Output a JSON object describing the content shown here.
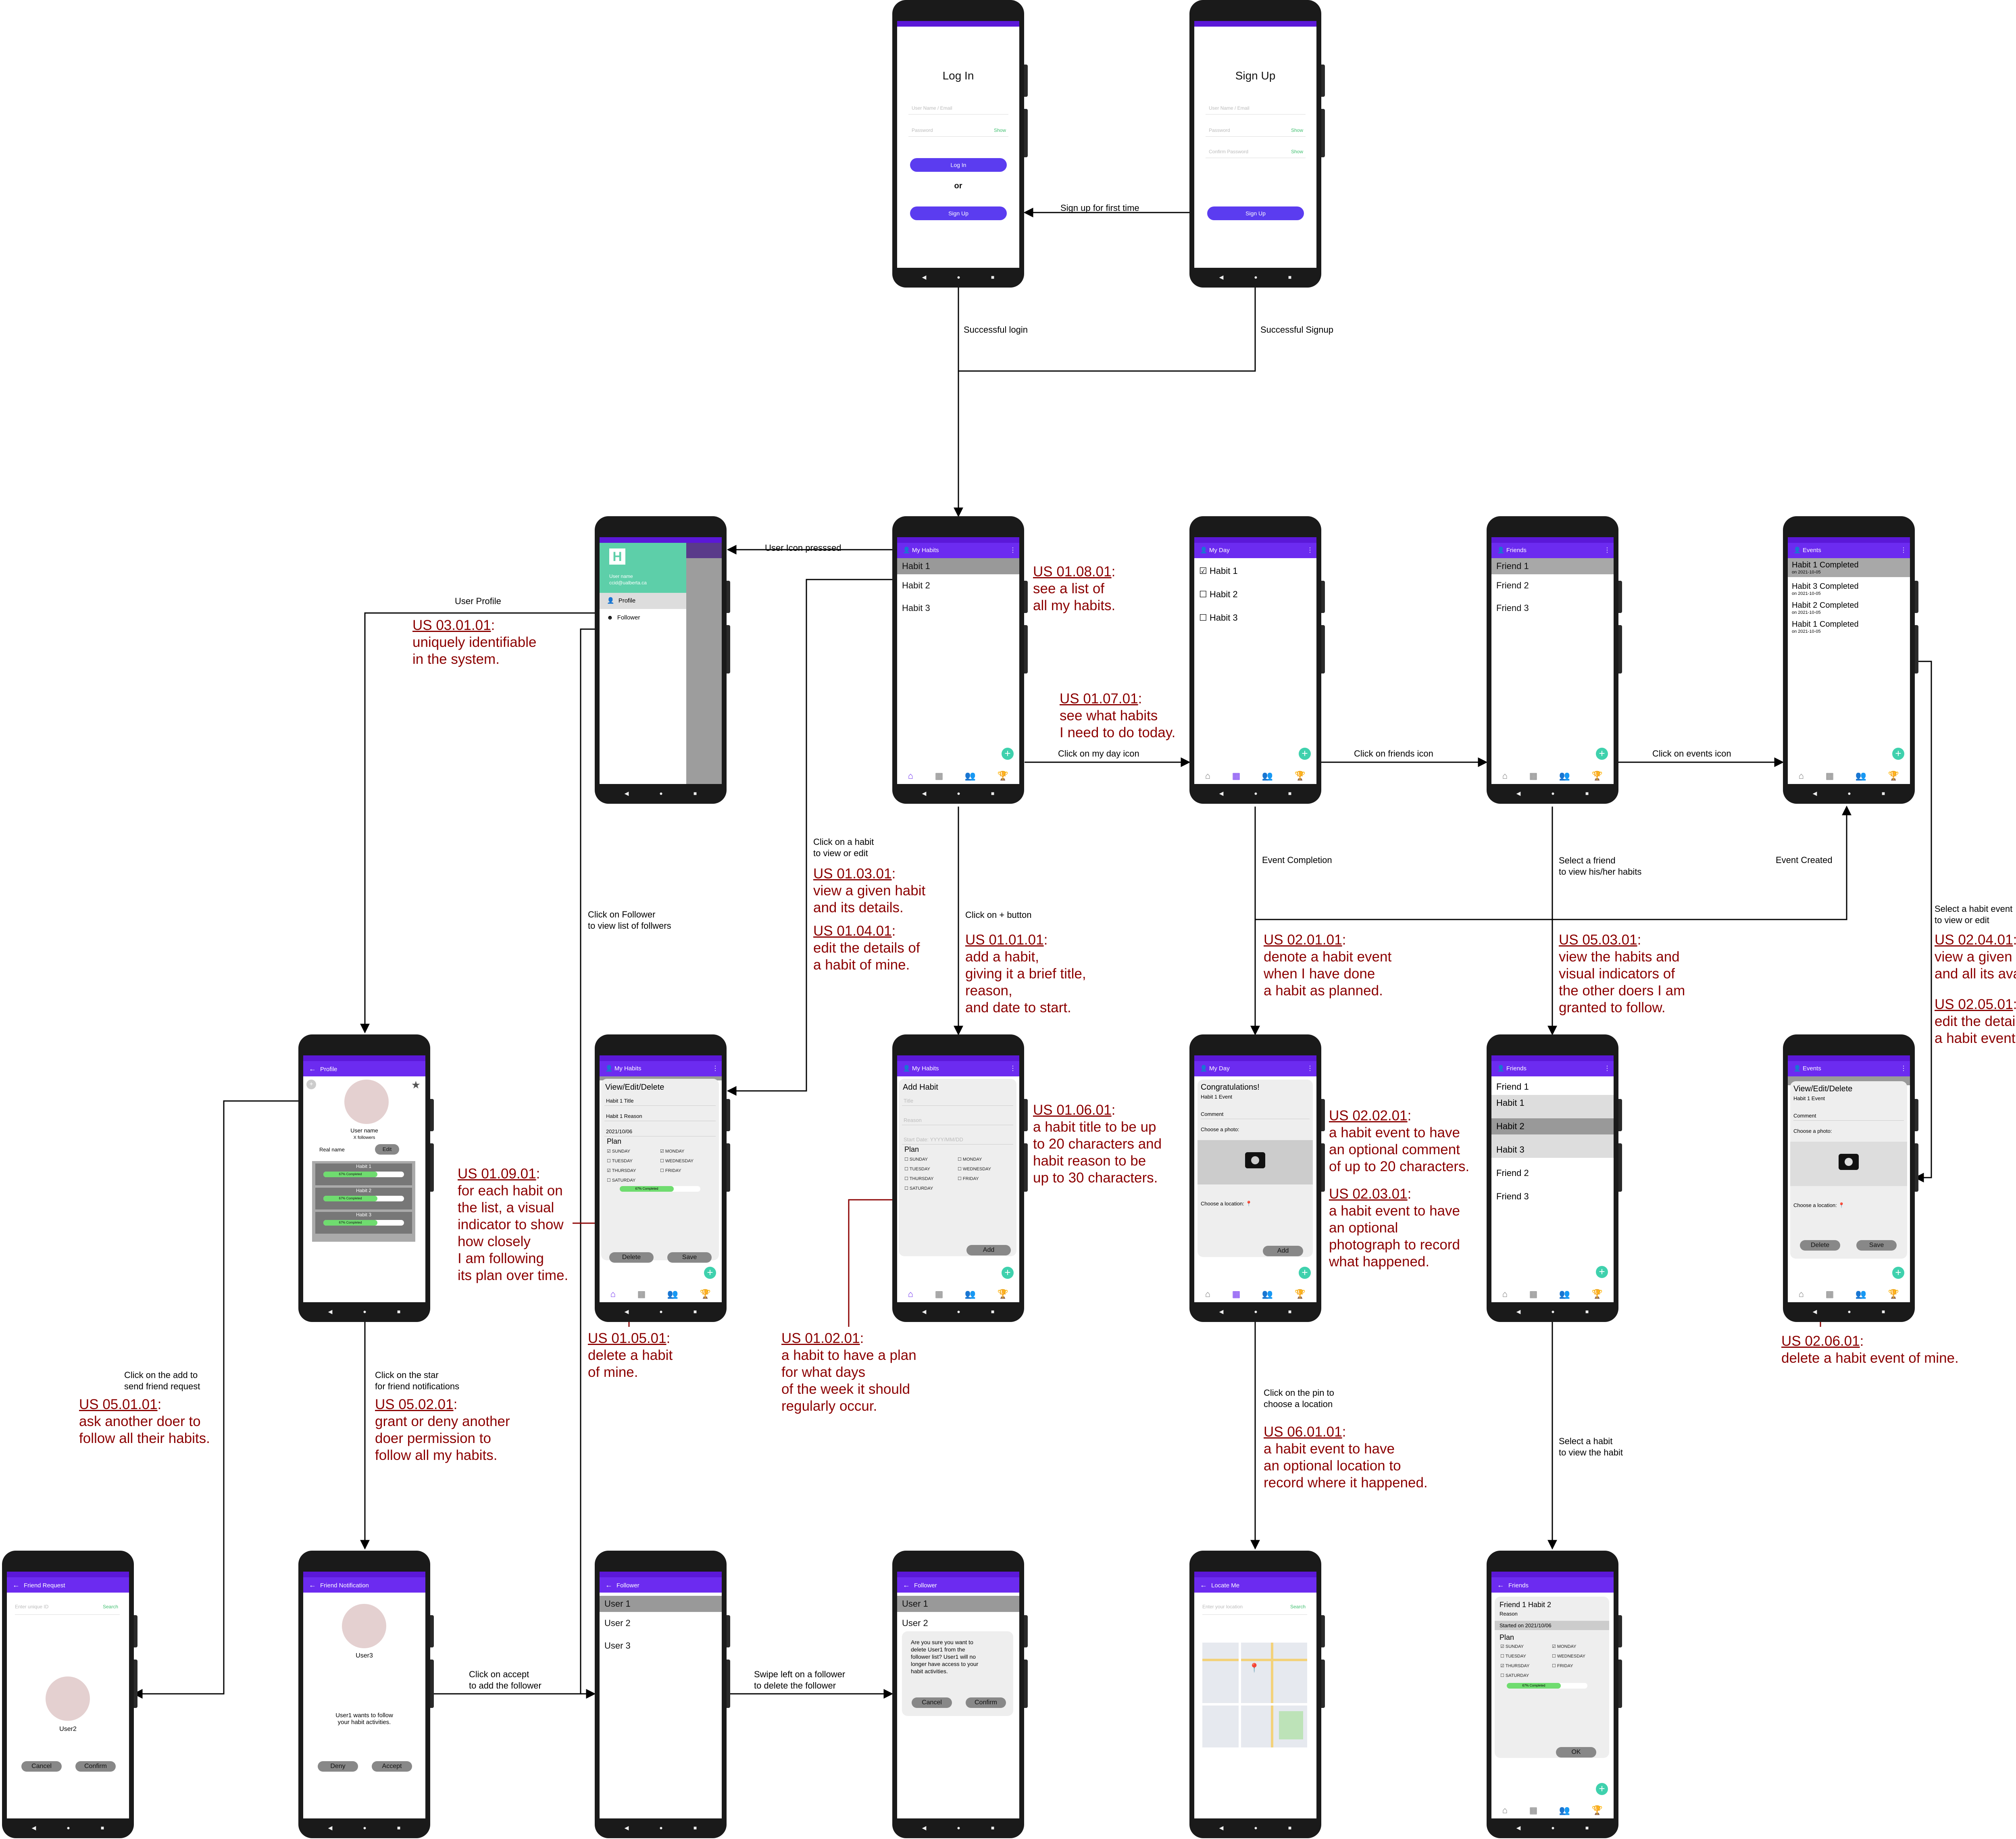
{
  "phones": {
    "login": {
      "title": "Log In",
      "user_ph": "User Name / Email",
      "pass_ph": "Password",
      "show": "Show",
      "login_btn": "Log In",
      "or": "or",
      "signup_btn": "Sign Up"
    },
    "signup": {
      "title": "Sign Up",
      "user_ph": "User Name / Email",
      "pass_ph": "Password",
      "confirm_ph": "Confirm Password",
      "show": "Show",
      "signup_btn": "Sign Up"
    },
    "drawer": {
      "user": "User name",
      "email": "ccid@ualberta.ca",
      "profile": "Profile",
      "follower": "Follower"
    },
    "myhabits": {
      "title": "My Habits",
      "items": [
        "Habit 1",
        "Habit 2",
        "Habit 3"
      ]
    },
    "myday": {
      "title": "My Day",
      "items": [
        "Habit 1",
        "Habit 2",
        "Habit 3"
      ]
    },
    "friends": {
      "title": "Friends",
      "items": [
        "Friend 1",
        "Friend 2",
        "Friend 3"
      ]
    },
    "events": {
      "title": "Events",
      "items": [
        {
          "t": "Habit 1 Completed",
          "d": "on 2021-10-05"
        },
        {
          "t": "Habit 3 Completed",
          "d": "on 2021-10-05"
        },
        {
          "t": "Habit 2 Completed",
          "d": "on 2021-10-05"
        },
        {
          "t": "Habit 1 Completed",
          "d": "on 2021-10-05"
        }
      ]
    },
    "profile": {
      "title": "Profile",
      "user": "User name",
      "followers": "X followers",
      "real": "Real name",
      "edit": "Edit",
      "habits": [
        "Habit 1",
        "Habit 2",
        "Habit 3"
      ],
      "progress": "67% Completed"
    },
    "vedhabit": {
      "title": "My Habits",
      "card": "View/Edit/Delete",
      "t": "Habit 1 Title",
      "r": "Habit 1 Reason",
      "date": "2021/10/06",
      "plan": "Plan",
      "days": [
        "SUNDAY",
        "MONDAY",
        "TUESDAY",
        "WEDNESDAY",
        "THURSDAY",
        "FRIDAY",
        "SATURDAY"
      ],
      "progress": "67% Completed",
      "delete": "Delete",
      "save": "Save"
    },
    "addhabit": {
      "title": "My Habits",
      "card": "Add Habit",
      "t": "Title",
      "r": "Reason",
      "date": "Start Date: YYYY/MM/DD",
      "plan": "Plan",
      "days": [
        "SUNDAY",
        "MONDAY",
        "TUESDAY",
        "WEDNESDAY",
        "THURSDAY",
        "FRIDAY",
        "SATURDAY"
      ],
      "add": "Add"
    },
    "congrats": {
      "title": "My Day",
      "card": "Congratulations!",
      "ev": "Habit 1 Event",
      "comment": "Comment",
      "photo": "Choose a photo:",
      "loc": "Choose a location:",
      "add": "Add"
    },
    "friends2": {
      "title": "Friends",
      "items": [
        "Friend 1",
        "Habit 1",
        "Habit 2",
        "Habit 3",
        "Friend 2",
        "Friend 3"
      ]
    },
    "vedevent": {
      "title": "Events",
      "card": "View/Edit/Delete",
      "ev": "Habit 1 Event",
      "comment": "Comment",
      "photo": "Choose a photo:",
      "loc": "Choose a location:",
      "delete": "Delete",
      "save": "Save"
    },
    "freq": {
      "title": "Friend Request",
      "ph": "Enter unique ID",
      "search": "Search",
      "user": "User2",
      "cancel": "Cancel",
      "confirm": "Confirm"
    },
    "fnotif": {
      "title": "Friend Notification",
      "user": "User3",
      "msg1": "User1 wants to follow",
      "msg2": "your habit activities.",
      "deny": "Deny",
      "accept": "Accept"
    },
    "follower": {
      "title": "Follower",
      "items": [
        "User 1",
        "User 2",
        "User 3"
      ]
    },
    "follower2": {
      "title": "Follower",
      "items": [
        "User 1",
        "User 2"
      ],
      "msg": [
        "Are you sure you want to",
        "delete User1 from the",
        "follower list? User1 will no",
        "longer have access to your",
        "habit activities."
      ],
      "cancel": "Cancel",
      "confirm": "Confirm"
    },
    "locate": {
      "title": "Locate Me",
      "ph": "Enter your location",
      "search": "Search"
    },
    "fhabit": {
      "title": "Friends",
      "card": "Friend 1 Habit 2",
      "reason": "Reason",
      "started": "Started on 2021/10/06",
      "plan": "Plan",
      "days": [
        "SUNDAY",
        "MONDAY",
        "TUESDAY",
        "WEDNESDAY",
        "THURSDAY",
        "FRIDAY",
        "SATURDAY"
      ],
      "progress": "67% Completed",
      "ok": "OK"
    }
  },
  "edge_labels": {
    "signup_first": "Sign up for first time",
    "succ_login": "Successful login",
    "succ_signup": "Successful Signup",
    "user_icon": "User Icon presssed",
    "user_profile": "User Profile",
    "click_myday": "Click on my day icon",
    "click_friends": "Click on friends icon",
    "click_events": "Click on events icon",
    "click_habit": [
      "Click on a habit",
      "to view or edit"
    ],
    "click_plus": "Click on + button",
    "click_follower": [
      "Click on Follower",
      "to view list of follwers"
    ],
    "event_completion": "Event Completion",
    "select_friend": [
      "Select a friend",
      "to view his/her habits"
    ],
    "event_created": "Event Created",
    "select_event": [
      "Select a habit event",
      "to view or edit"
    ],
    "click_add_send": [
      "Click on the add to",
      "send friend request"
    ],
    "click_star": [
      "Click on the star",
      "for friend notifications"
    ],
    "click_pin": [
      "Click on the pin to",
      "choose a location"
    ],
    "select_habit": [
      "Select a habit",
      "to view the habit"
    ],
    "click_accept": [
      "Click on accept",
      "to add the follower"
    ],
    "swipe_left": [
      "Swipe left on a follower",
      "to delete the follower"
    ]
  },
  "requirements": [
    {
      "id": "US 03.01.01",
      "lines": [
        "uniquely identifiable",
        "in the system."
      ]
    },
    {
      "id": "US 01.08.01",
      "lines": [
        "see a list of",
        "all my habits."
      ]
    },
    {
      "id": "US 01.07.01",
      "lines": [
        "see what habits",
        "I need to do today."
      ]
    },
    {
      "id": "US 01.03.01",
      "lines": [
        "view a given habit",
        "and its details."
      ]
    },
    {
      "id": "US 01.04.01",
      "lines": [
        "edit the details of",
        "a habit of mine."
      ]
    },
    {
      "id": "US 01.01.01",
      "lines": [
        "add a habit,",
        "giving it a brief title,",
        "reason,",
        "and date to start."
      ]
    },
    {
      "id": "US 02.01.01",
      "lines": [
        "denote a habit event",
        "when I have done",
        "a habit as planned."
      ]
    },
    {
      "id": "US 05.03.01",
      "lines": [
        "view the habits and",
        "visual indicators of",
        "the other doers I am",
        "granted to follow."
      ]
    },
    {
      "id": "US 02.04.01",
      "lines": [
        "view a given habit event",
        "and all its available details."
      ]
    },
    {
      "id": "US 02.05.01",
      "lines": [
        "edit the details of",
        "a habit event of mine."
      ]
    },
    {
      "id": "US 01.09.01",
      "lines": [
        "for each habit on",
        "the list, a visual",
        "indicator to show",
        "how closely",
        "I am following",
        "its plan over time."
      ]
    },
    {
      "id": "US 01.06.01",
      "lines": [
        "a habit title to be up",
        "to 20 characters and",
        "habit reason to be",
        "up to 30 characters."
      ]
    },
    {
      "id": "US 02.02.01",
      "lines": [
        "a habit event to have",
        "an optional comment",
        "of up to 20 characters."
      ]
    },
    {
      "id": "US 02.03.01",
      "lines": [
        "a habit event to have",
        "an optional",
        "photograph to record",
        "what happened."
      ]
    },
    {
      "id": "US 01.05.01",
      "lines": [
        "delete a habit",
        "of mine."
      ]
    },
    {
      "id": "US 01.02.01",
      "lines": [
        "a habit to have a plan",
        "for what days",
        "of the week it should",
        "regularly occur."
      ]
    },
    {
      "id": "US 02.06.01",
      "lines": [
        "delete a habit event of mine."
      ]
    },
    {
      "id": "US 05.01.01",
      "lines": [
        "ask another doer to",
        "follow all their habits."
      ]
    },
    {
      "id": "US 05.02.01",
      "lines": [
        "grant or deny another",
        "doer permission to",
        "follow all my habits."
      ]
    },
    {
      "id": "US 06.01.01",
      "lines": [
        "a habit event to have",
        "an optional location to",
        "record where it happened."
      ]
    }
  ]
}
